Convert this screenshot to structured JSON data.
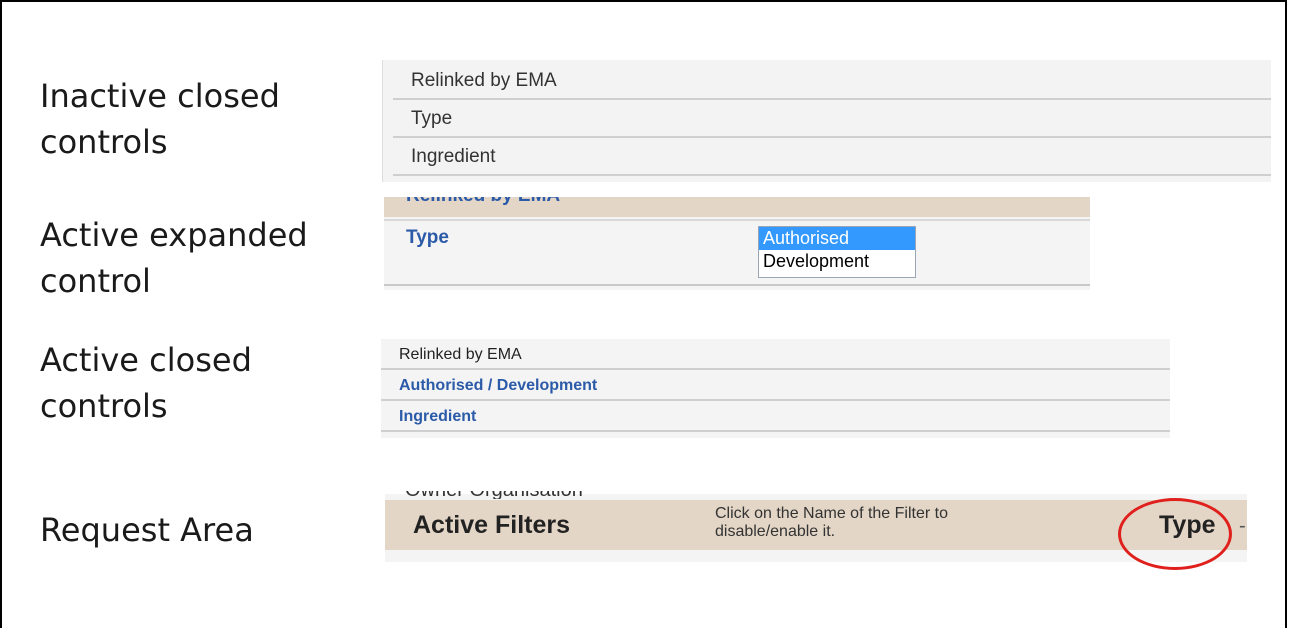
{
  "labels": {
    "row1_line1": "Inactive closed",
    "row1_line2": "controls",
    "row2_line1": "Active expanded",
    "row2_line2": "control",
    "row3_line1": "Active closed",
    "row3_line2": "controls",
    "row4": "Request Area"
  },
  "inactive_closed": {
    "items": [
      "Relinked by EMA",
      "Type",
      "Ingredient"
    ]
  },
  "active_expanded": {
    "clipped_header": "Relinked by EMA",
    "control_label": "Type",
    "options": [
      "Authorised",
      "Development"
    ],
    "selected": "Authorised",
    "colors": {
      "link": "#2b5aa8",
      "selection": "#3399ff",
      "band": "#e3d6c6"
    }
  },
  "active_closed": {
    "items": [
      "Relinked by EMA",
      "Authorised / Development",
      "Ingredient"
    ]
  },
  "request_area": {
    "clipped_above": "Owner Organisation",
    "title": "Active Filters",
    "hint": "Click on the Name of the Filter to disable/enable it.",
    "filter_link": "Type",
    "tail_glyph": "-",
    "highlight_color": "#e0201c"
  }
}
